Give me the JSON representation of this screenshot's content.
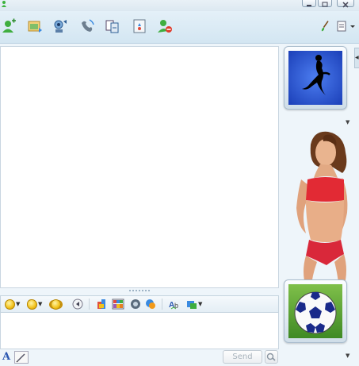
{
  "window": {
    "title": "",
    "controls": [
      "minimize-icon",
      "restore-icon",
      "close-icon"
    ]
  },
  "toolbar": {
    "buttons": [
      {
        "name": "invite-contact-icon"
      },
      {
        "name": "send-files-icon"
      },
      {
        "name": "webcam-icon"
      },
      {
        "name": "call-icon"
      },
      {
        "name": "share-folders-icon"
      },
      {
        "name": "activities-icon"
      },
      {
        "name": "block-contact-icon"
      }
    ],
    "right": [
      {
        "name": "paint-brush-icon"
      },
      {
        "name": "menu-icon"
      }
    ]
  },
  "format_bar": {
    "buttons": [
      "emoticon-icon",
      "wink-icon",
      "nudge-icon",
      "voice-clip-icon",
      "handwriting-icon",
      "backgrounds-icon",
      "games-icon",
      "translate-icon",
      "font-style-icon",
      "more-options-icon"
    ]
  },
  "compose": {
    "font_button": "A",
    "send_label": "Send"
  },
  "sidebar": {
    "contact_avatar": "silhouette-figure",
    "display_picture": "person-photo",
    "own_avatar": "soccer-ball"
  },
  "colors": {
    "toolbar_bg": "#d8e9f4",
    "avatar_blue": "#2a5bd8",
    "send_disabled_text": "#a9b3bc"
  }
}
